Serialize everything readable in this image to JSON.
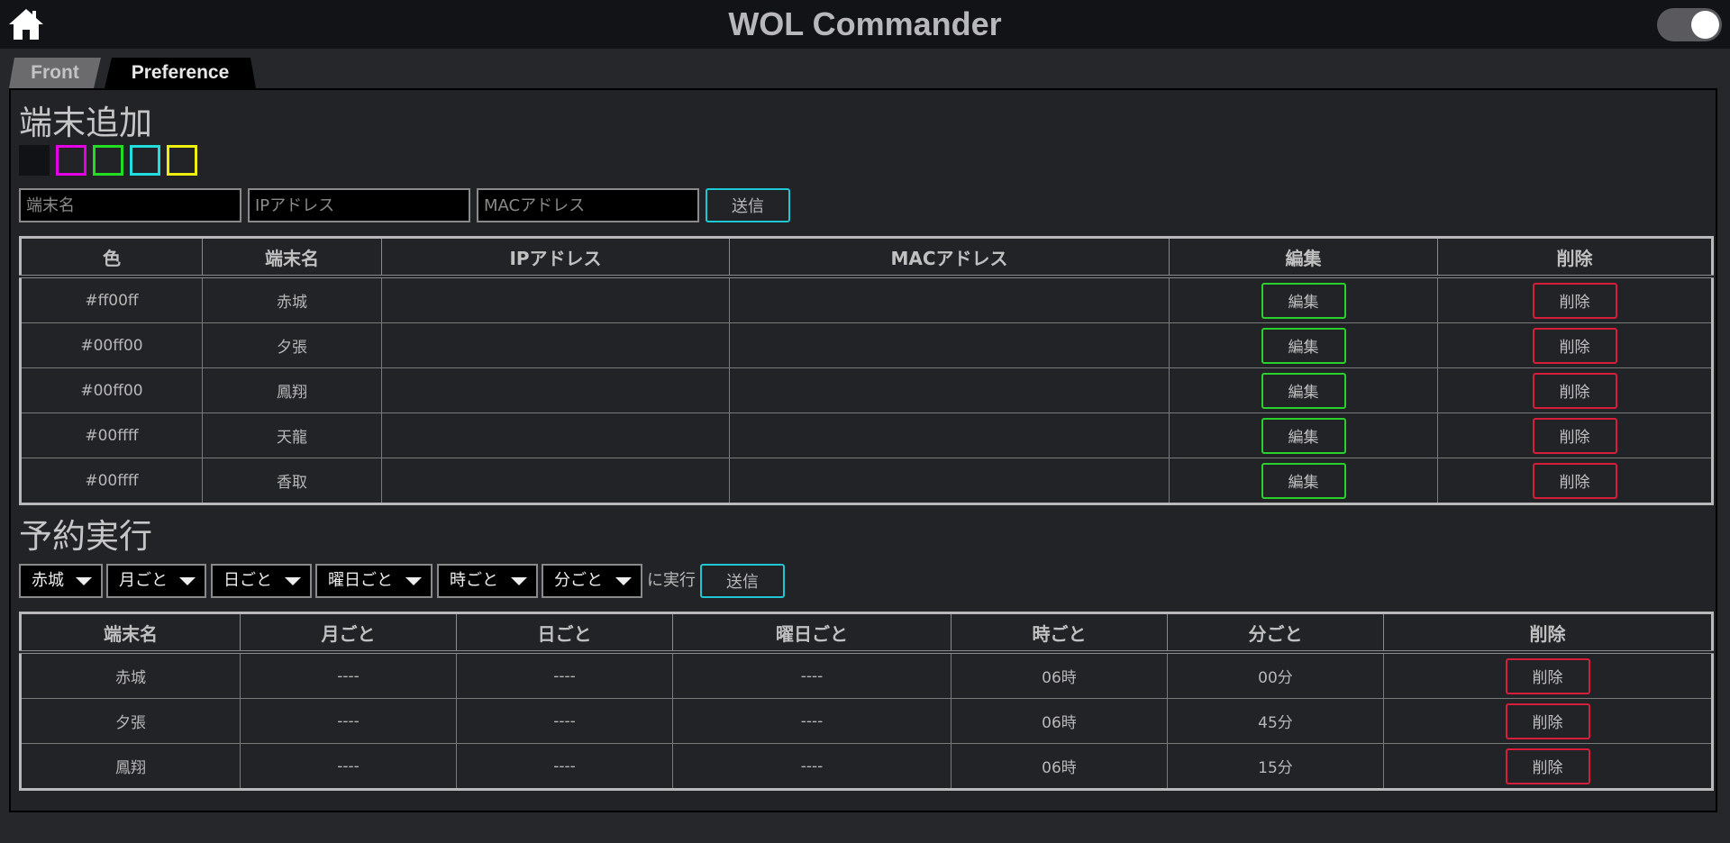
{
  "header": {
    "title": "WOL Commander",
    "home_icon": "home-icon",
    "theme_toggle": "on"
  },
  "tabs": [
    {
      "label": "Front",
      "active": false
    },
    {
      "label": "Preference",
      "active": true
    }
  ],
  "device_add": {
    "title": "端末追加",
    "swatches": [
      "#111216",
      "#e600e6",
      "#22dd22",
      "#22dddd",
      "#eeee11"
    ],
    "name_placeholder": "端末名",
    "ip_placeholder": "IPアドレス",
    "mac_placeholder": "MACアドレス",
    "submit_label": "送信"
  },
  "device_table": {
    "headers": [
      "色",
      "端末名",
      "IPアドレス",
      "MACアドレス",
      "編集",
      "削除"
    ],
    "rows": [
      {
        "color": "#ff00ff",
        "name": "赤城",
        "ip": "",
        "mac": ""
      },
      {
        "color": "#00ff00",
        "name": "夕張",
        "ip": "",
        "mac": ""
      },
      {
        "color": "#00ff00",
        "name": "鳳翔",
        "ip": "",
        "mac": ""
      },
      {
        "color": "#00ffff",
        "name": "天龍",
        "ip": "",
        "mac": ""
      },
      {
        "color": "#00ffff",
        "name": "香取",
        "ip": "",
        "mac": ""
      }
    ],
    "edit_label": "編集",
    "delete_label": "削除"
  },
  "schedule": {
    "title": "予約実行",
    "selects": [
      "赤城",
      "月ごと",
      "日ごと",
      "曜日ごと",
      "時ごと",
      "分ごと"
    ],
    "exec_label": "に実行",
    "submit_label": "送信"
  },
  "schedule_table": {
    "headers": [
      "端末名",
      "月ごと",
      "日ごと",
      "曜日ごと",
      "時ごと",
      "分ごと",
      "削除"
    ],
    "rows": [
      {
        "name": "赤城",
        "month": "----",
        "day": "----",
        "weekday": "----",
        "hour": "06時",
        "minute": "00分"
      },
      {
        "name": "夕張",
        "month": "----",
        "day": "----",
        "weekday": "----",
        "hour": "06時",
        "minute": "45分"
      },
      {
        "name": "鳳翔",
        "month": "----",
        "day": "----",
        "weekday": "----",
        "hour": "06時",
        "minute": "15分"
      }
    ],
    "delete_label": "削除"
  }
}
